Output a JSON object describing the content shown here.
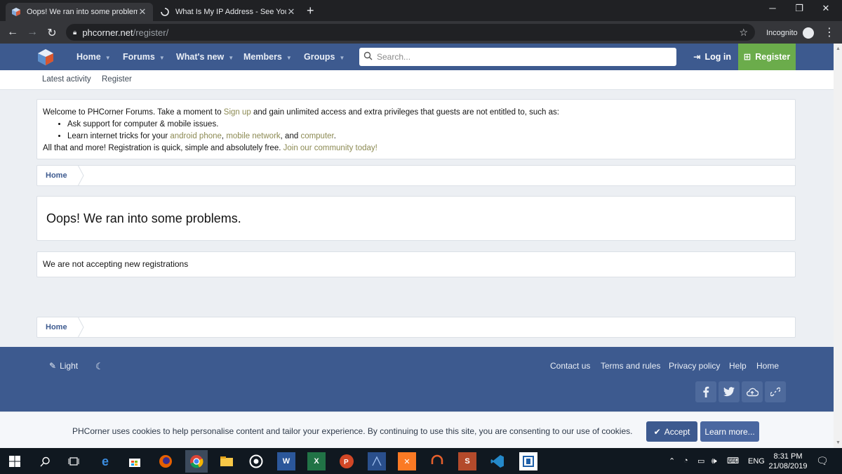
{
  "browser": {
    "tabs": [
      {
        "title": "Oops! We ran into some problems"
      },
      {
        "title": "What Is My IP Address - See Your"
      }
    ],
    "new_tab": "+",
    "url_host": "phcorner.net",
    "url_path": "/register/",
    "incognito_label": "Incognito"
  },
  "site": {
    "nav": [
      {
        "label": "Home"
      },
      {
        "label": "Forums"
      },
      {
        "label": "What's new"
      },
      {
        "label": "Members"
      },
      {
        "label": "Groups"
      }
    ],
    "search_placeholder": "Search...",
    "login_label": "Log in",
    "register_label": "Register",
    "subnav": [
      {
        "label": "Latest activity"
      },
      {
        "label": "Register"
      }
    ]
  },
  "notice": {
    "intro": "Welcome to PHCorner Forums. Take a moment to ",
    "signup": "Sign up",
    "intro2": " and gain unlimited access and extra privileges that guests are not entitled to, such as:",
    "bullet1": "Ask support for computer & mobile issues.",
    "bullet2_pre": "Learn internet tricks for your ",
    "bullet2_a": "android phone",
    "bullet2_c1": ", ",
    "bullet2_b": "mobile network",
    "bullet2_c2": ", and ",
    "bullet2_c": "computer",
    "bullet2_end": ".",
    "outro": "All that and more! Registration is quick, simple and absolutely free. ",
    "join": "Join our community today!"
  },
  "breadcrumb": {
    "home": "Home"
  },
  "error": {
    "title": "Oops! We ran into some problems.",
    "message": "We are not accepting new registrations"
  },
  "footer": {
    "style_label": "Light",
    "links": [
      {
        "label": "Contact us"
      },
      {
        "label": "Terms and rules"
      },
      {
        "label": "Privacy policy"
      },
      {
        "label": "Help"
      },
      {
        "label": "Home"
      }
    ]
  },
  "cookie": {
    "text": "PHCorner uses cookies to help personalise content and tailor your experience. By continuing to use this site, you are consenting to our use of cookies.",
    "accept": "Accept",
    "learn_more": "Learn more..."
  },
  "taskbar": {
    "language": "ENG",
    "time": "8:31 PM",
    "date": "21/08/2019"
  },
  "colors": {
    "brand_blue": "#3d5a8f",
    "register_green": "#6bac4b",
    "link_olive": "#8c8a53"
  }
}
